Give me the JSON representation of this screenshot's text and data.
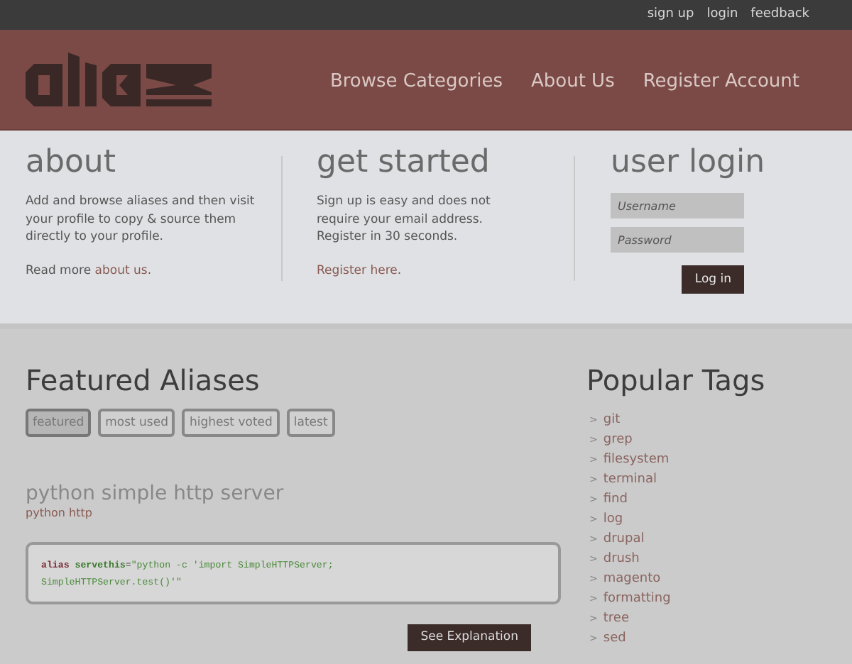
{
  "top_links": [
    {
      "label": "sign up"
    },
    {
      "label": "login"
    },
    {
      "label": "feedback"
    }
  ],
  "nav": [
    {
      "label": "Browse Categories"
    },
    {
      "label": "About Us"
    },
    {
      "label": "Register Account"
    }
  ],
  "about": {
    "title": "about",
    "body": "Add and browse aliases and then visit your profile to copy & source them directly to your profile.",
    "more_prefix": "Read more",
    "more_link": "about us",
    "more_suffix": "."
  },
  "get_started": {
    "title": "get started",
    "body": "Sign up is easy and does not require your email address. Register in 30 seconds.",
    "link": "Register here",
    "suffix": "."
  },
  "login": {
    "title": "user login",
    "username_placeholder": "Username",
    "password_placeholder": "Password",
    "button": "Log in"
  },
  "featured": {
    "title": "Featured Aliases",
    "filters": [
      {
        "label": "featured",
        "selected": true
      },
      {
        "label": "most used",
        "selected": false
      },
      {
        "label": "highest voted",
        "selected": false
      },
      {
        "label": "latest",
        "selected": false
      }
    ],
    "alias": {
      "title": "python simple http server",
      "tags": "python http",
      "code": [
        {
          "kind": "keyword",
          "text": "alias"
        },
        {
          "kind": "name",
          "text": " servethis"
        },
        {
          "kind": "operator",
          "text": "="
        },
        {
          "kind": "string",
          "text": "\"python -c 'import SimpleHTTPServer; SimpleHTTPServer.test()'\""
        }
      ],
      "button": "See Explanation"
    }
  },
  "popular_tags": {
    "title": "Popular Tags",
    "items": [
      {
        "bullet": ">",
        "label": "git"
      },
      {
        "bullet": ">",
        "label": "grep"
      },
      {
        "bullet": ">",
        "label": "filesystem"
      },
      {
        "bullet": ">",
        "label": "terminal"
      },
      {
        "bullet": ">",
        "label": "find"
      },
      {
        "bullet": ">",
        "label": "log"
      },
      {
        "bullet": ">",
        "label": "drupal"
      },
      {
        "bullet": ">",
        "label": "drush"
      },
      {
        "bullet": ">",
        "label": "magento"
      },
      {
        "bullet": ">",
        "label": "formatting"
      },
      {
        "bullet": ">",
        "label": "tree"
      },
      {
        "bullet": ">",
        "label": "sed"
      }
    ]
  }
}
